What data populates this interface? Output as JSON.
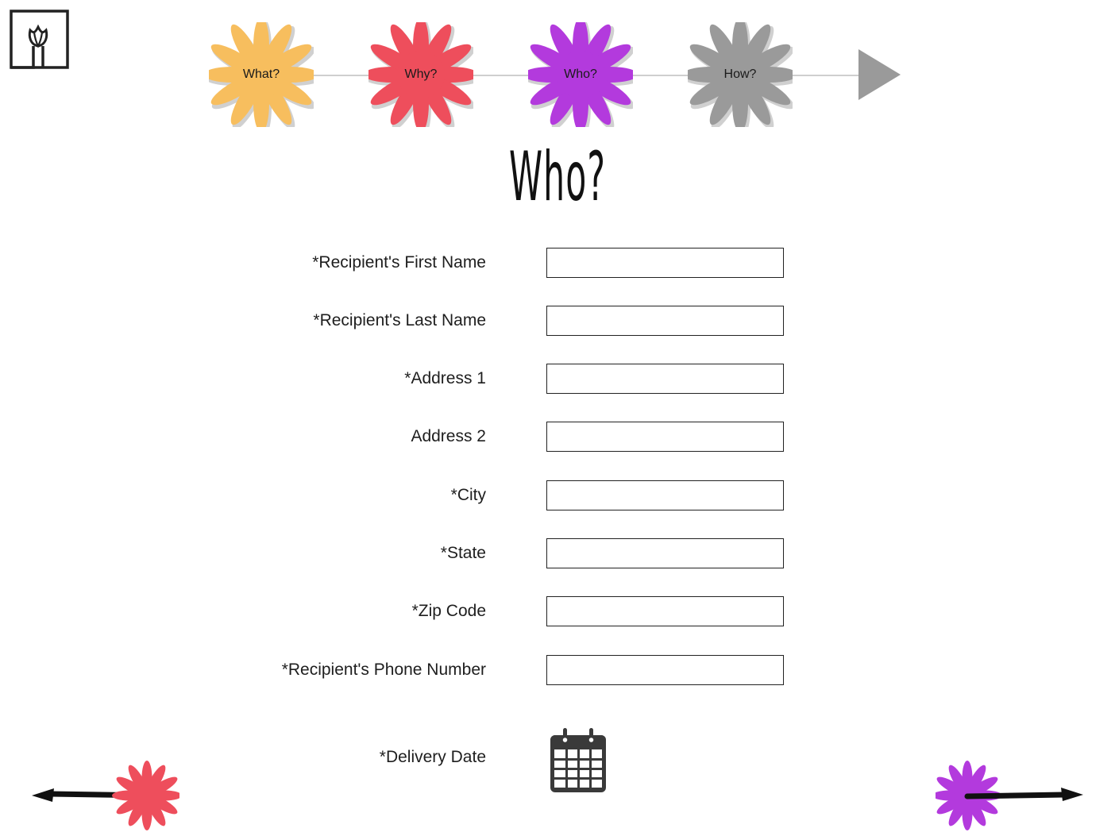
{
  "header": {
    "logo_icon": "tulip-frame-logo-icon"
  },
  "progress": {
    "steps": [
      {
        "label": "What?",
        "color": "#F7BE5E"
      },
      {
        "label": "Why?",
        "color": "#EE4E5C"
      },
      {
        "label": "Who?",
        "color": "#B33ADD"
      },
      {
        "label": "How?",
        "color": "#9A9A9A"
      }
    ],
    "active_step": "Who?",
    "next_icon": "play-arrow-icon"
  },
  "page": {
    "title": "Who?"
  },
  "form": {
    "fields": [
      {
        "label": "*Recipient's First Name",
        "value": ""
      },
      {
        "label": "*Recipient's Last Name",
        "value": ""
      },
      {
        "label": "*Address 1",
        "value": ""
      },
      {
        "label": "Address 2",
        "value": ""
      },
      {
        "label": "*City",
        "value": ""
      },
      {
        "label": "*State",
        "value": ""
      },
      {
        "label": "*Zip Code",
        "value": ""
      },
      {
        "label": "*Recipient's Phone Number",
        "value": ""
      }
    ],
    "delivery_date": {
      "label": "*Delivery Date",
      "icon": "calendar-icon"
    }
  },
  "navigation": {
    "back": {
      "icon": "left-arrow-icon",
      "flower_color": "#EE4E5C"
    },
    "forward": {
      "icon": "right-arrow-icon",
      "flower_color": "#B33ADD"
    }
  }
}
